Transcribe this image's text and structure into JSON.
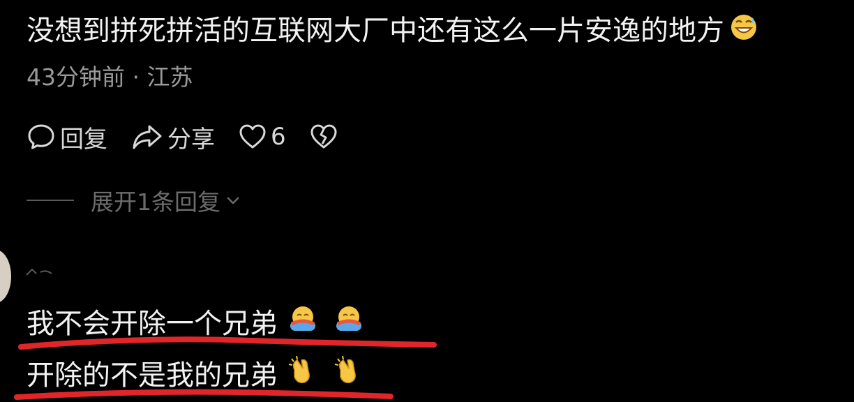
{
  "comment": {
    "text": "没想到拼死拼活的互联网大厂中还有这么一片安逸的地方",
    "emoji": "grinning-sweat-emoji",
    "time": "43分钟前",
    "separator": "·",
    "location": "江苏"
  },
  "actions": {
    "reply_label": "回复",
    "share_label": "分享",
    "like_count": "6"
  },
  "expand": {
    "label": "展开1条回复"
  },
  "reply": {
    "line1": "我不会开除一个兄弟",
    "line2": "开除的不是我的兄弟",
    "line1_emoji": "hugging-emoji",
    "line2_emoji": "clapping-hands-emoji"
  },
  "colors": {
    "background": "#000000",
    "text_primary": "#f2f2f2",
    "text_secondary": "#9a9a9a",
    "text_muted": "#6c6c6c",
    "underline": "#e0262b"
  }
}
